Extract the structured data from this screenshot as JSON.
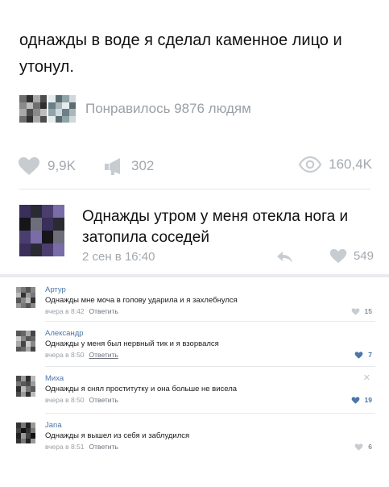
{
  "post": {
    "text": "однажды в воде я сделал каменное лицо и утонул.",
    "liked_by_text": "Понравилось 9876 людям",
    "stats": {
      "likes": "9,9K",
      "reposts": "302",
      "views": "160,4K"
    },
    "icons": {
      "like": "heart-icon",
      "repost": "megaphone-icon",
      "views": "eye-icon"
    }
  },
  "featured_comment": {
    "text": "Однажды утром у меня отекла нога и затопила соседей",
    "time": "2 сен в 16:40",
    "likes": "549"
  },
  "comments": [
    {
      "author": "Артур",
      "text": "Однажды мне моча в голову ударила и я захлебнулся",
      "time": "вчера в 8:42",
      "reply": "Ответить",
      "likes": "15",
      "liked": false
    },
    {
      "author": "Александр",
      "text": "Однажды у меня был нервный тик и я взорвался",
      "time": "вчера в 8:50",
      "reply": "Ответить",
      "likes": "7",
      "liked": true
    },
    {
      "author": "Миха",
      "text": "Однажды я снял проститутку и она больше не висела",
      "time": "вчера в 8:50",
      "reply": "Ответить",
      "likes": "19",
      "liked": true
    },
    {
      "author": "Jana",
      "text": "Однажды я вышел из себя и заблудился",
      "time": "вчера в 8:51",
      "reply": "Ответить",
      "likes": "6",
      "liked": false
    }
  ],
  "colors": {
    "link": "#4a76a8",
    "muted": "#a2a8ae",
    "liked": "#4a76a8"
  }
}
